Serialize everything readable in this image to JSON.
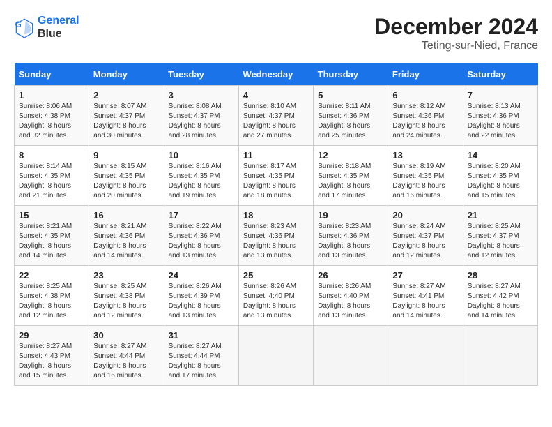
{
  "logo": {
    "line1": "General",
    "line2": "Blue"
  },
  "title": "December 2024",
  "subtitle": "Teting-sur-Nied, France",
  "days_of_week": [
    "Sunday",
    "Monday",
    "Tuesday",
    "Wednesday",
    "Thursday",
    "Friday",
    "Saturday"
  ],
  "weeks": [
    [
      {
        "day": "1",
        "sunrise": "Sunrise: 8:06 AM",
        "sunset": "Sunset: 4:38 PM",
        "daylight": "Daylight: 8 hours and 32 minutes."
      },
      {
        "day": "2",
        "sunrise": "Sunrise: 8:07 AM",
        "sunset": "Sunset: 4:37 PM",
        "daylight": "Daylight: 8 hours and 30 minutes."
      },
      {
        "day": "3",
        "sunrise": "Sunrise: 8:08 AM",
        "sunset": "Sunset: 4:37 PM",
        "daylight": "Daylight: 8 hours and 28 minutes."
      },
      {
        "day": "4",
        "sunrise": "Sunrise: 8:10 AM",
        "sunset": "Sunset: 4:37 PM",
        "daylight": "Daylight: 8 hours and 27 minutes."
      },
      {
        "day": "5",
        "sunrise": "Sunrise: 8:11 AM",
        "sunset": "Sunset: 4:36 PM",
        "daylight": "Daylight: 8 hours and 25 minutes."
      },
      {
        "day": "6",
        "sunrise": "Sunrise: 8:12 AM",
        "sunset": "Sunset: 4:36 PM",
        "daylight": "Daylight: 8 hours and 24 minutes."
      },
      {
        "day": "7",
        "sunrise": "Sunrise: 8:13 AM",
        "sunset": "Sunset: 4:36 PM",
        "daylight": "Daylight: 8 hours and 22 minutes."
      }
    ],
    [
      {
        "day": "8",
        "sunrise": "Sunrise: 8:14 AM",
        "sunset": "Sunset: 4:35 PM",
        "daylight": "Daylight: 8 hours and 21 minutes."
      },
      {
        "day": "9",
        "sunrise": "Sunrise: 8:15 AM",
        "sunset": "Sunset: 4:35 PM",
        "daylight": "Daylight: 8 hours and 20 minutes."
      },
      {
        "day": "10",
        "sunrise": "Sunrise: 8:16 AM",
        "sunset": "Sunset: 4:35 PM",
        "daylight": "Daylight: 8 hours and 19 minutes."
      },
      {
        "day": "11",
        "sunrise": "Sunrise: 8:17 AM",
        "sunset": "Sunset: 4:35 PM",
        "daylight": "Daylight: 8 hours and 18 minutes."
      },
      {
        "day": "12",
        "sunrise": "Sunrise: 8:18 AM",
        "sunset": "Sunset: 4:35 PM",
        "daylight": "Daylight: 8 hours and 17 minutes."
      },
      {
        "day": "13",
        "sunrise": "Sunrise: 8:19 AM",
        "sunset": "Sunset: 4:35 PM",
        "daylight": "Daylight: 8 hours and 16 minutes."
      },
      {
        "day": "14",
        "sunrise": "Sunrise: 8:20 AM",
        "sunset": "Sunset: 4:35 PM",
        "daylight": "Daylight: 8 hours and 15 minutes."
      }
    ],
    [
      {
        "day": "15",
        "sunrise": "Sunrise: 8:21 AM",
        "sunset": "Sunset: 4:35 PM",
        "daylight": "Daylight: 8 hours and 14 minutes."
      },
      {
        "day": "16",
        "sunrise": "Sunrise: 8:21 AM",
        "sunset": "Sunset: 4:36 PM",
        "daylight": "Daylight: 8 hours and 14 minutes."
      },
      {
        "day": "17",
        "sunrise": "Sunrise: 8:22 AM",
        "sunset": "Sunset: 4:36 PM",
        "daylight": "Daylight: 8 hours and 13 minutes."
      },
      {
        "day": "18",
        "sunrise": "Sunrise: 8:23 AM",
        "sunset": "Sunset: 4:36 PM",
        "daylight": "Daylight: 8 hours and 13 minutes."
      },
      {
        "day": "19",
        "sunrise": "Sunrise: 8:23 AM",
        "sunset": "Sunset: 4:36 PM",
        "daylight": "Daylight: 8 hours and 13 minutes."
      },
      {
        "day": "20",
        "sunrise": "Sunrise: 8:24 AM",
        "sunset": "Sunset: 4:37 PM",
        "daylight": "Daylight: 8 hours and 12 minutes."
      },
      {
        "day": "21",
        "sunrise": "Sunrise: 8:25 AM",
        "sunset": "Sunset: 4:37 PM",
        "daylight": "Daylight: 8 hours and 12 minutes."
      }
    ],
    [
      {
        "day": "22",
        "sunrise": "Sunrise: 8:25 AM",
        "sunset": "Sunset: 4:38 PM",
        "daylight": "Daylight: 8 hours and 12 minutes."
      },
      {
        "day": "23",
        "sunrise": "Sunrise: 8:25 AM",
        "sunset": "Sunset: 4:38 PM",
        "daylight": "Daylight: 8 hours and 12 minutes."
      },
      {
        "day": "24",
        "sunrise": "Sunrise: 8:26 AM",
        "sunset": "Sunset: 4:39 PM",
        "daylight": "Daylight: 8 hours and 13 minutes."
      },
      {
        "day": "25",
        "sunrise": "Sunrise: 8:26 AM",
        "sunset": "Sunset: 4:40 PM",
        "daylight": "Daylight: 8 hours and 13 minutes."
      },
      {
        "day": "26",
        "sunrise": "Sunrise: 8:26 AM",
        "sunset": "Sunset: 4:40 PM",
        "daylight": "Daylight: 8 hours and 13 minutes."
      },
      {
        "day": "27",
        "sunrise": "Sunrise: 8:27 AM",
        "sunset": "Sunset: 4:41 PM",
        "daylight": "Daylight: 8 hours and 14 minutes."
      },
      {
        "day": "28",
        "sunrise": "Sunrise: 8:27 AM",
        "sunset": "Sunset: 4:42 PM",
        "daylight": "Daylight: 8 hours and 14 minutes."
      }
    ],
    [
      {
        "day": "29",
        "sunrise": "Sunrise: 8:27 AM",
        "sunset": "Sunset: 4:43 PM",
        "daylight": "Daylight: 8 hours and 15 minutes."
      },
      {
        "day": "30",
        "sunrise": "Sunrise: 8:27 AM",
        "sunset": "Sunset: 4:44 PM",
        "daylight": "Daylight: 8 hours and 16 minutes."
      },
      {
        "day": "31",
        "sunrise": "Sunrise: 8:27 AM",
        "sunset": "Sunset: 4:44 PM",
        "daylight": "Daylight: 8 hours and 17 minutes."
      },
      null,
      null,
      null,
      null
    ]
  ]
}
